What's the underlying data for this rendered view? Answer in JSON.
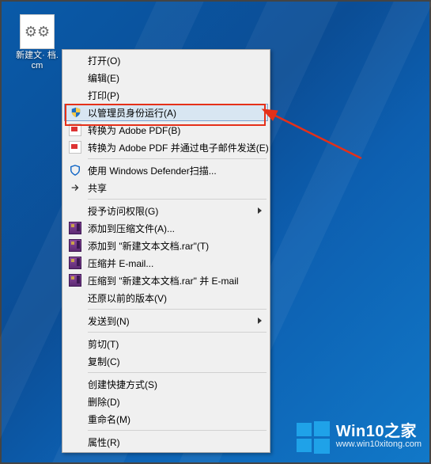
{
  "desktop_icon": {
    "label": "新建文本文档.cmd",
    "display_label": "新建文·\n档.cm"
  },
  "menu": {
    "open": "打开(O)",
    "edit": "编辑(E)",
    "print": "打印(P)",
    "run_as_admin": "以管理员身份运行(A)",
    "conv_adobe_pdf": "转换为 Adobe PDF(B)",
    "conv_adobe_pdf_email": "转换为 Adobe PDF 并通过电子邮件发送(E)",
    "defender_scan": "使用 Windows Defender扫描...",
    "share": "共享",
    "grant_access": "授予访问权限(G)",
    "add_to_archive": "添加到压缩文件(A)...",
    "add_to_named_rar": "添加到 \"新建文本文档.rar\"(T)",
    "compress_email": "压缩并 E-mail...",
    "compress_named_email": "压缩到 \"新建文本文档.rar\" 并 E-mail",
    "restore_prev": "还原以前的版本(V)",
    "send_to": "发送到(N)",
    "cut": "剪切(T)",
    "copy": "复制(C)",
    "create_shortcut": "创建快捷方式(S)",
    "delete": "删除(D)",
    "rename": "重命名(M)",
    "properties": "属性(R)"
  },
  "watermark": {
    "title": "Win10之家",
    "url": "www.win10xitong.com"
  },
  "colors": {
    "highlight_border": "#e53019",
    "menu_hover": "#d8e6f2"
  }
}
